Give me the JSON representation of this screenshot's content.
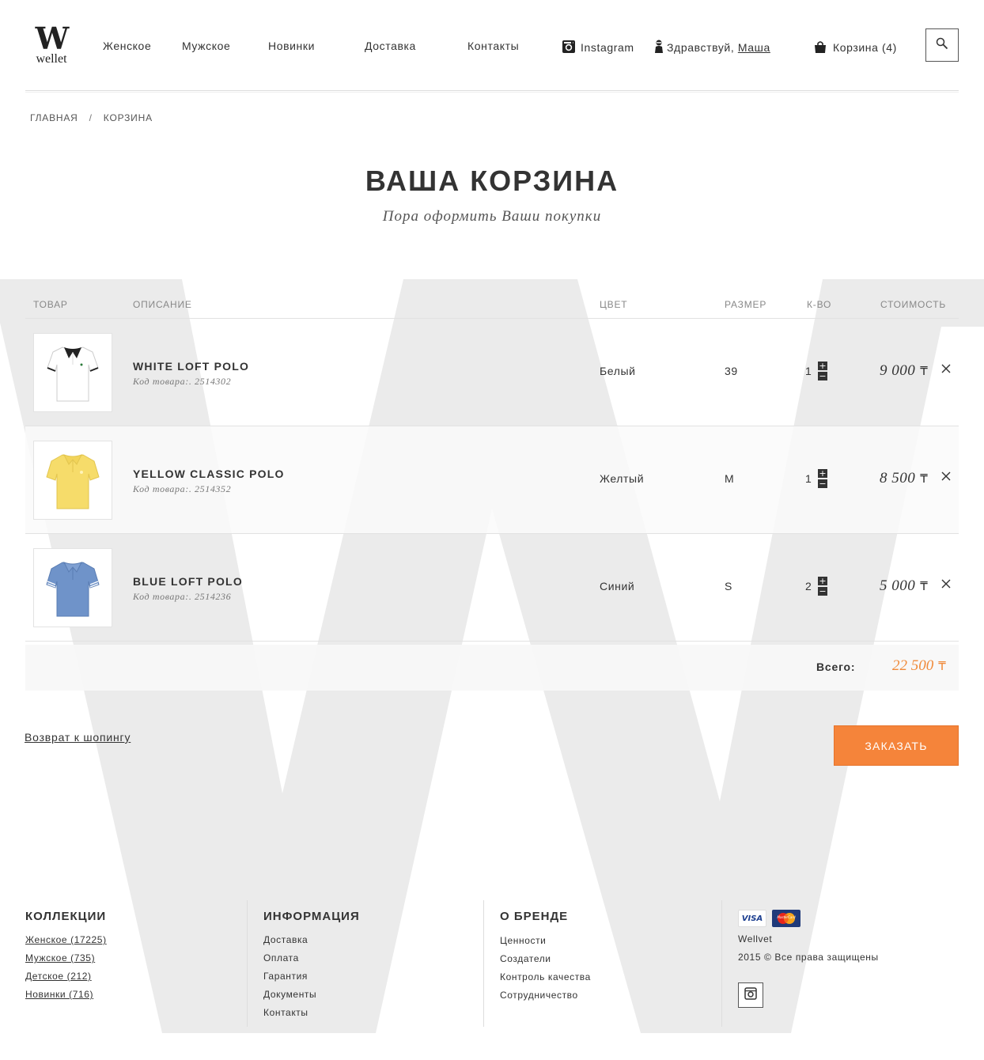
{
  "brand": {
    "mark": "W",
    "name": "wellet"
  },
  "nav": {
    "women": "Женское",
    "men": "Мужское",
    "new": "Новинки",
    "delivery": "Доставка",
    "contacts": "Контакты",
    "instagram": "Instagram",
    "greeting": "Здравствуй, ",
    "user": "Маша",
    "cart": "Корзина (4)"
  },
  "breadcrumb": {
    "home": "ГЛАВНАЯ",
    "sep": "/",
    "current": "КОРЗИНА"
  },
  "page": {
    "title": "ВАША КОРЗИНА",
    "subtitle": "Пора оформить Ваши покупки"
  },
  "table": {
    "headers": {
      "product": "ТОВАР",
      "description": "ОПИСАНИЕ",
      "color": "ЦВЕТ",
      "size": "РАЗМЕР",
      "qty": "К-ВО",
      "cost": "СТОИМОСТЬ"
    },
    "rows": [
      {
        "name": "WHITE LOFT POLO",
        "code": "Код товара:. 2514302",
        "color": "Белый",
        "size": "39",
        "qty": "1",
        "price": "9 000",
        "currency": "₸"
      },
      {
        "name": "YELLOW CLASSIC POLO",
        "code": "Код товара:. 2514352",
        "color": "Желтый",
        "size": "M",
        "qty": "1",
        "price": "8 500",
        "currency": "₸"
      },
      {
        "name": "BLUE LOFT POLO",
        "code": "Код товара:. 2514236",
        "color": "Синий",
        "size": "S",
        "qty": "2",
        "price": "5 000",
        "currency": "₸"
      }
    ],
    "total_label": "Всего:",
    "total_value": "22 500",
    "currency": "₸"
  },
  "actions": {
    "back": "Возврат к шопингу",
    "order": "ЗАКАЗАТЬ"
  },
  "footer": {
    "collections": {
      "title": "КОЛЛЕКЦИИ",
      "items": [
        "Женское (17225)",
        "Мужское (735)",
        "Детское (212)",
        "Новинки (716)"
      ]
    },
    "info": {
      "title": "ИНФОРМАЦИЯ",
      "items": [
        "Доставка",
        "Оплата",
        "Гарантия",
        "Документы",
        "Контакты"
      ]
    },
    "brand": {
      "title": "О БРЕНДЕ",
      "items": [
        "Ценности",
        "Создатели",
        "Контроль качества",
        "Сотрудничество"
      ]
    },
    "company": "Wellvet",
    "copyright": "2015 © Все права защищены",
    "visa": "VISA",
    "mastercard": "MasterCard"
  },
  "colors": {
    "accent": "#f5843a",
    "total": "#f08a3a",
    "text": "#333333",
    "watermark": "#ebebeb",
    "polo_white": "#ffffff",
    "polo_yellow": "#f6dc6a",
    "polo_blue": "#6f93c9"
  }
}
